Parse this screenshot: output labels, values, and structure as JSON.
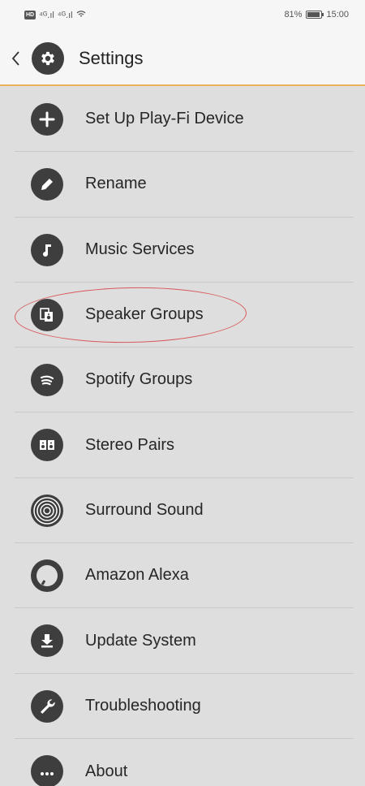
{
  "status_bar": {
    "hd": "HD",
    "signal_1": "⁴ᴳ.ıl",
    "signal_2": "⁴ᴳ.ıl",
    "battery_text": "81%",
    "time": "15:00"
  },
  "header": {
    "back_icon": "chevron-left-icon",
    "settings_icon": "gear-icon",
    "title": "Settings"
  },
  "menu": {
    "items": [
      {
        "label": "Set Up Play-Fi Device",
        "icon": "plus-icon"
      },
      {
        "label": "Rename",
        "icon": "pencil-icon"
      },
      {
        "label": "Music Services",
        "icon": "music-note-icon"
      },
      {
        "label": "Speaker Groups",
        "icon": "speaker-groups-icon"
      },
      {
        "label": "Spotify Groups",
        "icon": "spotify-icon"
      },
      {
        "label": "Stereo Pairs",
        "icon": "stereo-pairs-icon"
      },
      {
        "label": "Surround Sound",
        "icon": "surround-sound-icon"
      },
      {
        "label": "Amazon Alexa",
        "icon": "alexa-icon"
      },
      {
        "label": "Update System",
        "icon": "download-icon"
      },
      {
        "label": "Troubleshooting",
        "icon": "wrench-icon"
      },
      {
        "label": "About",
        "icon": "ellipsis-icon"
      }
    ]
  },
  "colors": {
    "accent_rule": "#e8b25a",
    "highlight_annotation": "#d9585a",
    "icon_background": "#3e3e3e",
    "list_background": "#dedede"
  }
}
